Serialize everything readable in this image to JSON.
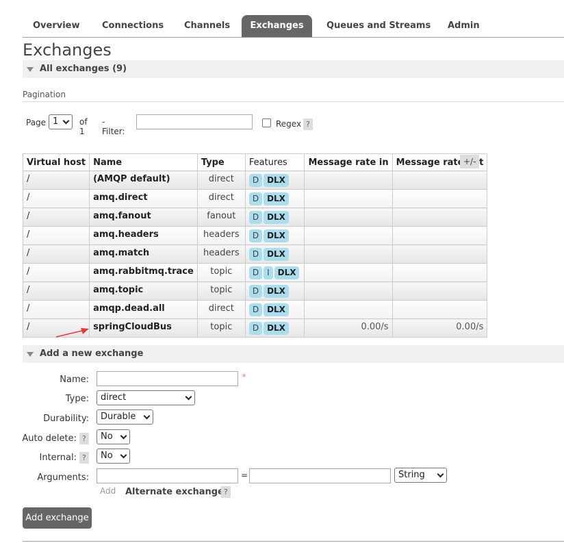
{
  "tabs": [
    "Overview",
    "Connections",
    "Channels",
    "Exchanges",
    "Queues and Streams",
    "Admin"
  ],
  "page_title": "Exchanges",
  "all_exchanges": "All exchanges (9)",
  "pagination": {
    "label": "Pagination",
    "page_label": "Page",
    "page_value": "1",
    "of_label": "of 1",
    "filter_label": "- Filter:",
    "filter_value": "",
    "regex_label": "Regex",
    "help": "?"
  },
  "table": {
    "headers": [
      "Virtual host",
      "Name",
      "Type",
      "Features",
      "Message rate in",
      "Message rate out"
    ],
    "columns_toggle": "+/-",
    "rows": [
      {
        "vhost": "/",
        "name": "(AMQP default)",
        "type": "direct",
        "features": [
          "D",
          "DLX"
        ],
        "rate_in": "",
        "rate_out": ""
      },
      {
        "vhost": "/",
        "name": "amq.direct",
        "type": "direct",
        "features": [
          "D",
          "DLX"
        ],
        "rate_in": "",
        "rate_out": ""
      },
      {
        "vhost": "/",
        "name": "amq.fanout",
        "type": "fanout",
        "features": [
          "D",
          "DLX"
        ],
        "rate_in": "",
        "rate_out": ""
      },
      {
        "vhost": "/",
        "name": "amq.headers",
        "type": "headers",
        "features": [
          "D",
          "DLX"
        ],
        "rate_in": "",
        "rate_out": ""
      },
      {
        "vhost": "/",
        "name": "amq.match",
        "type": "headers",
        "features": [
          "D",
          "DLX"
        ],
        "rate_in": "",
        "rate_out": ""
      },
      {
        "vhost": "/",
        "name": "amq.rabbitmq.trace",
        "type": "topic",
        "features": [
          "D",
          "I",
          "DLX"
        ],
        "rate_in": "",
        "rate_out": ""
      },
      {
        "vhost": "/",
        "name": "amq.topic",
        "type": "topic",
        "features": [
          "D",
          "DLX"
        ],
        "rate_in": "",
        "rate_out": ""
      },
      {
        "vhost": "/",
        "name": "amqp.dead.all",
        "type": "direct",
        "features": [
          "D",
          "DLX"
        ],
        "rate_in": "",
        "rate_out": ""
      },
      {
        "vhost": "/",
        "name": "springCloudBus",
        "type": "topic",
        "features": [
          "D",
          "DLX"
        ],
        "rate_in": "0.00/s",
        "rate_out": "0.00/s"
      }
    ]
  },
  "add_section": {
    "title": "Add a new exchange",
    "name_label": "Name:",
    "name_value": "",
    "required_mark": "*",
    "type_label": "Type:",
    "type_value": "direct",
    "durability_label": "Durability:",
    "durability_value": "Durable",
    "auto_delete_label": "Auto delete:",
    "auto_delete_value": "No",
    "internal_label": "Internal:",
    "internal_value": "No",
    "arguments_label": "Arguments:",
    "arg_key": "",
    "arg_equals": "=",
    "arg_value": "",
    "arg_type": "String",
    "add_link": "Add",
    "alternate_exchange": "Alternate exchange",
    "help": "?",
    "submit": "Add exchange"
  },
  "colors": {
    "accent": "#666666",
    "badge": "#aaddee",
    "arrow": "#e83a3a"
  },
  "icons": {
    "section_toggle": "triangle-down-icon",
    "annotation": "red-arrow-icon",
    "dropdown": "chevron-down-icon"
  }
}
